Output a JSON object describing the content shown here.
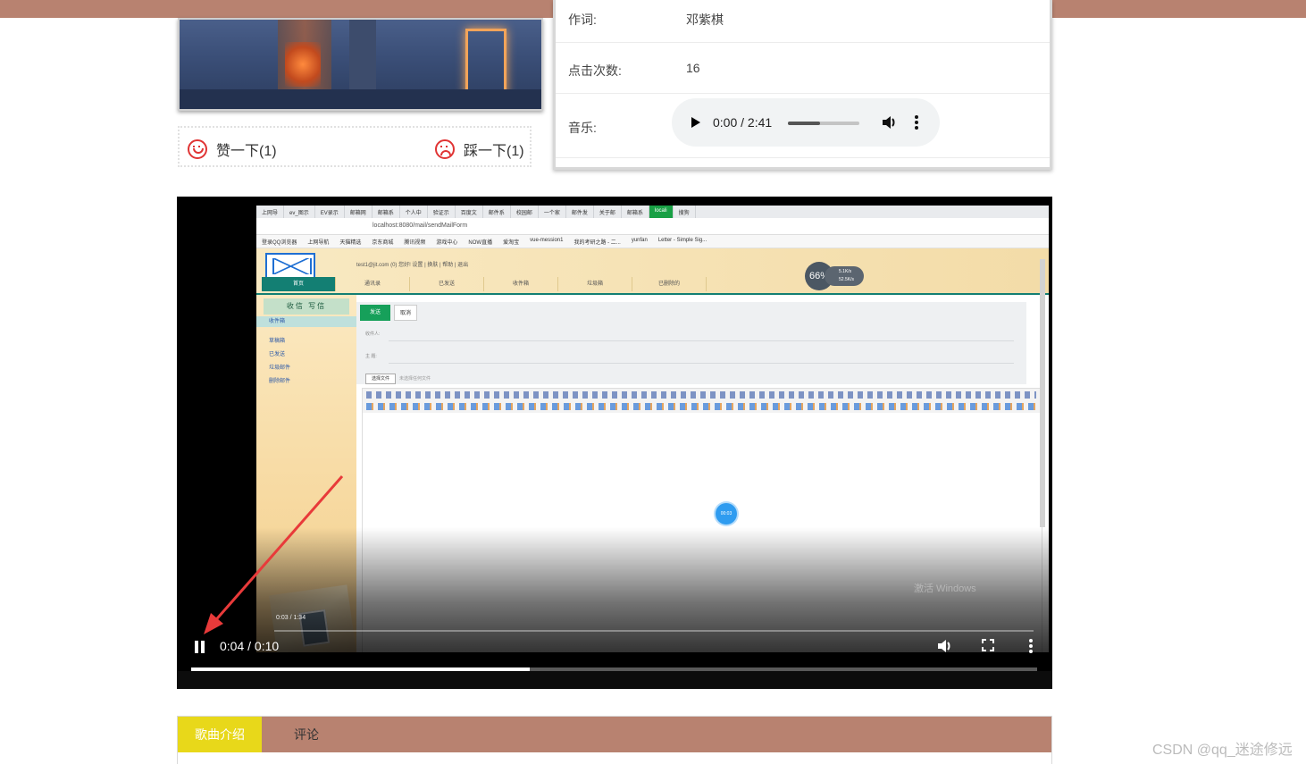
{
  "song": {
    "lyricist_label": "作词:",
    "lyricist_value": "邓紫棋",
    "clicks_label": "点击次数:",
    "clicks_value": "16",
    "music_label": "音乐:"
  },
  "audio": {
    "time": "0:00 / 2:41",
    "progress": 0.45
  },
  "votes": {
    "like": "赞一下(1)",
    "dislike": "踩一下(1)"
  },
  "video": {
    "time": "0:04 / 0:10",
    "progress": 0.4,
    "inner_time": "0:03 / 1:34",
    "browser_tabs": [
      "上网导",
      "ev_图示",
      "EV录示",
      "邮箱网",
      "邮箱系",
      "个人中",
      "验证示",
      "百度文",
      "邮件系",
      "校园邮",
      "一个家",
      "邮件发",
      "关于邮",
      "邮箱系",
      "locali",
      "搜狗"
    ],
    "url": "localhost:8080/mail/sendMailForm",
    "bookmarks": [
      "登录QQ浏览器",
      "上网导航",
      "天猫精选",
      "京东商城",
      "腾讯视频",
      "游戏中心",
      "NOW直播",
      "爱淘宝",
      "vue-mession1",
      "我的考研之路 - 二...",
      "yunfan",
      "Letter - Simple Sig..."
    ],
    "mail_user": "test1@jit.com (0) 您好!   设置 | 换肤 | 帮助 | 退出",
    "mail_nav": [
      "首页",
      "通讯录",
      "已发送",
      "收件箱",
      "垃圾箱",
      "已删除的"
    ],
    "speed": "66%",
    "speed_up": "5.1K/s",
    "speed_down": "52.5K/s",
    "sidebar_buttons": "收信  写信",
    "sidebar_items": [
      "收件箱",
      "草稿箱",
      "已发送",
      "垃圾邮件",
      "删除邮件"
    ],
    "send_label": "发送",
    "cancel_label": "取消",
    "to_label": "收件人:",
    "subject_label": "主  题:",
    "attach_label": "选择文件",
    "attach_hint": "未选择任何文件",
    "dot_label": "00:03",
    "windows_watermark": "激活 Windows"
  },
  "tabs": {
    "intro": "歌曲介绍",
    "comments": "评论"
  },
  "watermark": "CSDN @qq_迷途修远"
}
